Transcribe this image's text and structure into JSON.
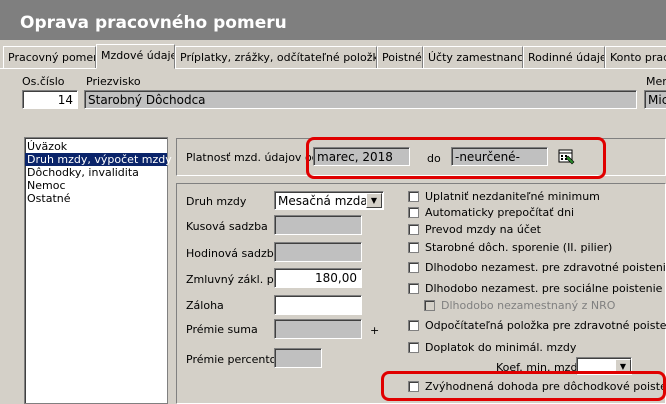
{
  "window": {
    "title": "Oprava pracovného pomeru"
  },
  "tabs": [
    {
      "label": "Pracovný pomer"
    },
    {
      "label": "Mzdové údaje"
    },
    {
      "label": "Príplatky, zrážky, odčítateľné položky ..."
    },
    {
      "label": "Poistné"
    },
    {
      "label": "Účty zamestnanca"
    },
    {
      "label": "Rodinné údaje"
    },
    {
      "label": "Konto pracov"
    }
  ],
  "header": {
    "oscislo_label": "Os.číslo",
    "oscislo_value": "14",
    "priezvisko_label": "Priezvisko",
    "priezvisko_value": "Starobný  Dôchodca",
    "meno_label": "Men",
    "meno_value": "Mic"
  },
  "sections": [
    {
      "label": "Úväzok"
    },
    {
      "label": "Druh mzdy, výpočet mzdy"
    },
    {
      "label": "Dôchodky, invalidita"
    },
    {
      "label": "Nemoc"
    },
    {
      "label": "Ostatné"
    }
  ],
  "platnost": {
    "label": "Platnosť mzd. údajov od",
    "from_value": "marec, 2018",
    "do_label": "do",
    "to_value": "-neurčené-"
  },
  "form": {
    "druh_mzdy_label": "Druh mzdy",
    "druh_mzdy_value": "Mesačná mzda",
    "kusova_label": "Kusová sadzba",
    "hodinova_label": "Hodinová sadzba",
    "zmluvny_label": "Zmluvný zákl. plat",
    "zmluvny_value": "180,00",
    "zaloha_label": "Záloha",
    "premie_suma_label": "Prémie suma",
    "plus_sign": "+",
    "premie_percento_label": "Prémie percento"
  },
  "options": [
    {
      "label": "Uplatniť nezdaniteľné minimum"
    },
    {
      "label": "Automaticky prepočítať dni"
    },
    {
      "label": "Prevod mzdy na účet"
    },
    {
      "label": "Starobné dôch. sporenie (II. pilier)"
    },
    {
      "label": "Dlhodobo nezamest. pre zdravotné poistenie"
    },
    {
      "label": "Dlhodobo nezamest. pre sociálne poistenie"
    },
    {
      "label": "Dlhodobo nezamestnaný z NRO"
    },
    {
      "label": "Odpočítateľná položka pre zdravotné poistenie"
    },
    {
      "label": "Doplatok do minimál. mzdy"
    },
    {
      "label": "Zvýhodnená dohoda pre dôchodkové poistenie"
    }
  ],
  "koef": {
    "label": "Koef. min. mzdy"
  },
  "colors": {
    "accent": "#0a246a",
    "highlight": "#e00000"
  }
}
